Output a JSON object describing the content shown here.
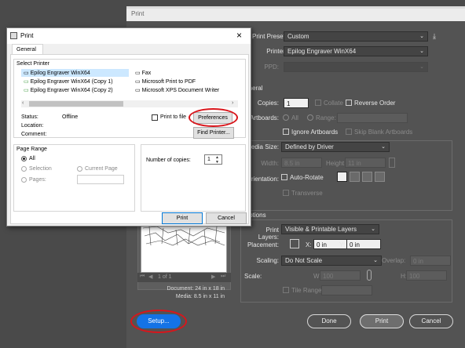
{
  "ai": {
    "title": "Print",
    "preset_label": "Print Preset:",
    "preset_value": "Custom",
    "printer_label": "Printer:",
    "printer_value": "Epilog Engraver WinX64",
    "ppd_label": "PPD:",
    "general_label": "General",
    "copies_label": "Copies:",
    "copies_value": "1",
    "collate_label": "Collate",
    "reverse_label": "Reverse Order",
    "artboards_label": "Artboards:",
    "all_label": "All",
    "range_label": "Range:",
    "ignore_label": "Ignore Artboards",
    "skip_label": "Skip Blank Artboards",
    "media_label": "Media Size:",
    "media_value": "Defined by Driver",
    "width_label": "Width:",
    "width_value": "8.5 in",
    "height_label": "Height:",
    "height_value": "11 in",
    "orientation_label": "Orientation:",
    "autorotate_label": "Auto-Rotate",
    "transverse_label": "Transverse",
    "options_label": "Options",
    "layers_label": "Print Layers:",
    "layers_value": "Visible & Printable Layers",
    "placement_label": "Placement:",
    "x_label": "X:",
    "x_value": "0 in",
    "y_label": "Y:",
    "y_value": "0 in",
    "scaling_label": "Scaling:",
    "scaling_value": "Do Not Scale",
    "overlap_label": "Overlap:",
    "overlap_value": "0 in",
    "scale_label": "Scale:",
    "w_label": "W:",
    "w_value": "100",
    "h_label": "H:",
    "h_value": "100",
    "tile_label": "Tile Range:",
    "page_nav": "1 of 1",
    "document_label": "Document: 24 in x 18 in",
    "media_info": "Media: 8.5 in x 11 in",
    "setup_button": "Setup...",
    "done_button": "Done",
    "print_button": "Print",
    "cancel_button": "Cancel"
  },
  "win": {
    "title": "Print",
    "close_glyph": "×",
    "tab_general": "General",
    "select_printer_label": "Select Printer",
    "printers": [
      "Epilog Engraver WinX64",
      "Epilog Engraver WinX64 (Copy 1)",
      "Epilog Engraver WinX64 (Copy 2)",
      "Fax",
      "Microsoft Print to PDF",
      "Microsoft XPS Document Writer"
    ],
    "status_label": "Status:",
    "status_value": "Offline",
    "location_label": "Location:",
    "comment_label": "Comment:",
    "print_to_file": "Print to file",
    "preferences_button": "Preferences",
    "find_printer_button": "Find Printer...",
    "page_range_label": "Page Range",
    "all_label": "All",
    "selection_label": "Selection",
    "current_page_label": "Current Page",
    "pages_label": "Pages:",
    "copies_label": "Number of copies:",
    "copies_value": "1",
    "print_button": "Print",
    "cancel_button": "Cancel"
  },
  "colors": {
    "ai_bg": "#535353",
    "accent": "#1473e6",
    "annotation": "#d9151b"
  }
}
